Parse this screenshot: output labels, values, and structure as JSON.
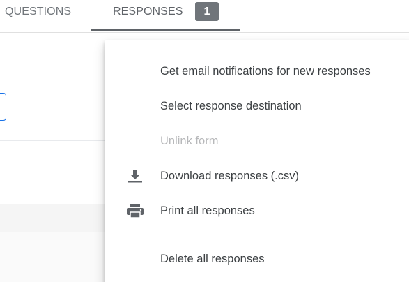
{
  "tabs": {
    "questions_label": "QUESTIONS",
    "responses_label": "RESPONSES",
    "responses_count": "1"
  },
  "menu": {
    "items": [
      {
        "label": "Get email notifications for new responses",
        "enabled": true
      },
      {
        "label": "Select response destination",
        "enabled": true
      },
      {
        "label": "Unlink form",
        "enabled": false
      },
      {
        "label": "Download responses (.csv)",
        "enabled": true,
        "icon": "download-icon"
      },
      {
        "label": "Print all responses",
        "enabled": true,
        "icon": "print-icon"
      },
      {
        "label": "Delete all responses",
        "enabled": true
      }
    ]
  },
  "colors": {
    "icon": "#5f6368",
    "text": "#3c4043",
    "disabled_text": "#b7b8ba",
    "badge_bg": "#70757a"
  }
}
